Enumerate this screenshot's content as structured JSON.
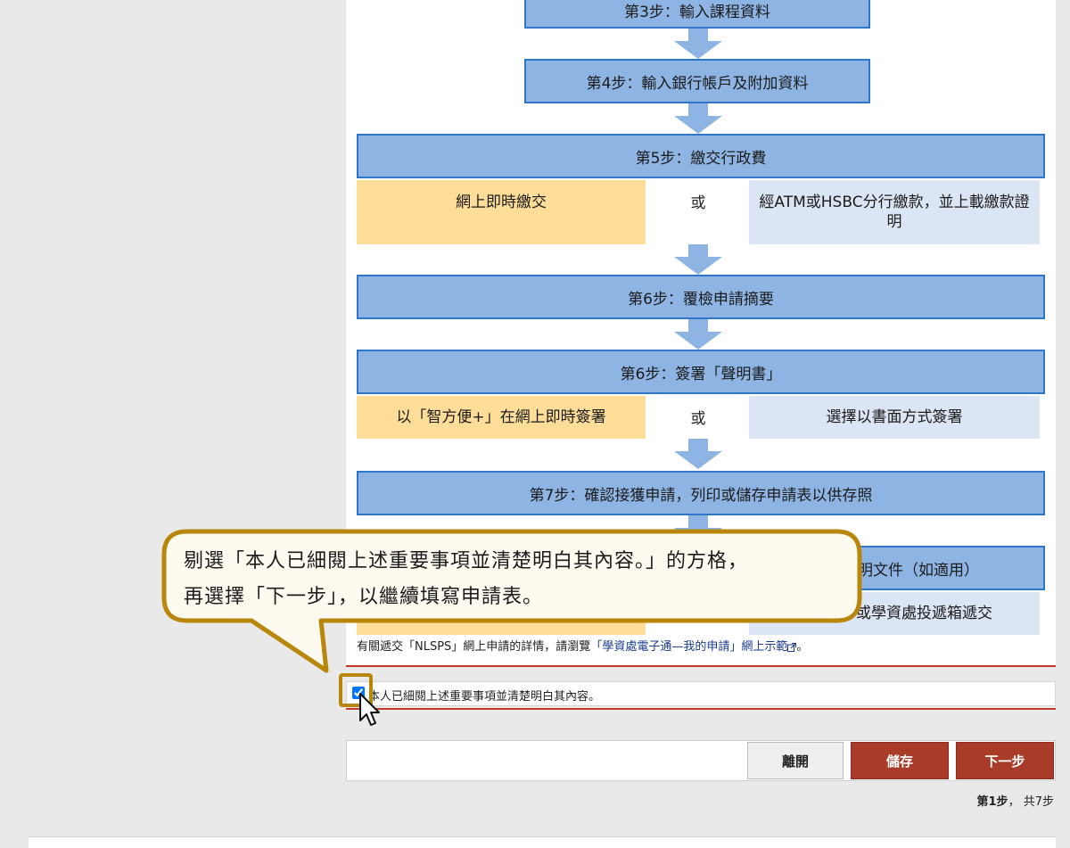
{
  "flow": {
    "step3": "第3步：輸入課程資料",
    "step4": "第4步：輸入銀行帳戶及附加資料",
    "step5": "第5步：繳交行政費",
    "step5_left": "網上即時繳交",
    "step5_or": "或",
    "step5_right": "經ATM或HSBC分行繳款，並上載繳款證明",
    "step6a": "第6步：覆檢申請摘要",
    "step6b": "第6步：簽署「聲明書」",
    "step6b_left": "以「智方便+」在網上即時簽署",
    "step6b_or": "或",
    "step6b_right": "選擇以書面方式簽署",
    "step7": "第7步：確認接獲申請，列印或儲存申請表以供存照",
    "step8_partial": "明文件（如適用）",
    "step8_right_partial": "或學資處投遞箱遞交"
  },
  "note": {
    "prefix": "有關遞交「NLSPS」網上申請的詳情，請瀏覽",
    "link": "「學資處電子通—我的申請」網上示範",
    "suffix": "。",
    "external_icon": "external-link-icon"
  },
  "confirm": {
    "checked": true,
    "label": "本人已細閱上述重要事項並清楚明白其內容。"
  },
  "buttons": {
    "leave": "離開",
    "save": "儲存",
    "next": "下一步"
  },
  "pager": {
    "current": "第1步",
    "separator": "，",
    "total": "共7步"
  },
  "callout": {
    "line1": "剔選「本人已細閱上述重要事項並清楚明白其內容。」的方格，",
    "line2": "再選擇「下一步」，以繼續填寫申請表。"
  },
  "colors": {
    "step_fill": "#8db4e3",
    "step_border": "#2f75c8",
    "option_orange": "#fedd98",
    "option_blue": "#dbe5f4",
    "button_red": "#a93b29",
    "callout_border": "#b8860b",
    "callout_fill": "#fffaf0"
  }
}
